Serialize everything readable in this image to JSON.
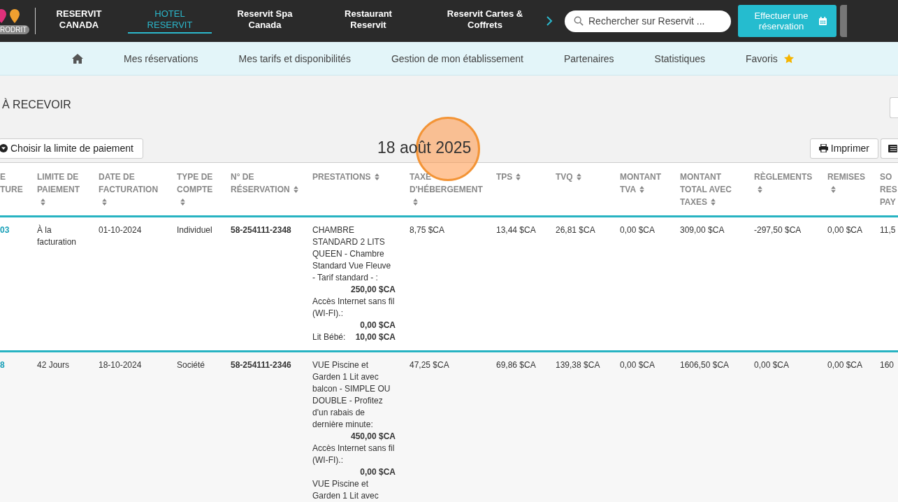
{
  "header": {
    "logo_badge": "RODRIT",
    "nav": [
      {
        "label": "RESERVIT CANADA",
        "selected": false
      },
      {
        "label": "HOTEL RESERVIT",
        "selected": true
      },
      {
        "label": "Reservit Spa Canada",
        "selected": false
      },
      {
        "label": "Restaurant Reservit",
        "selected": false
      },
      {
        "label": "Reservit Cartes & Coffrets",
        "selected": false
      }
    ],
    "search": {
      "placeholder": "Rechercher sur Reservit ..."
    },
    "booking_button": "Effectuer une réservation"
  },
  "subnav": [
    {
      "kind": "home"
    },
    {
      "kind": "text",
      "label": "Mes réservations"
    },
    {
      "kind": "text",
      "label": "Mes tarifs et disponibilités"
    },
    {
      "kind": "text",
      "label": "Gestion de mon établissement"
    },
    {
      "kind": "text",
      "label": "Partenaires"
    },
    {
      "kind": "text",
      "label": "Statistiques"
    },
    {
      "kind": "favorite",
      "label": "Favoris"
    }
  ],
  "page_title": "À RECEVOIR",
  "toolbar": {
    "filter_button": "Choisir la limite de paiement",
    "date": "18 août 2025",
    "print_button": "Imprimer"
  },
  "table": {
    "columns": [
      {
        "label": "E\nTURE",
        "kind": "link",
        "sortable": false
      },
      {
        "label": "LIMITE DE PAIEMENT",
        "kind": "text",
        "sortable": true
      },
      {
        "label": "DATE DE FACTURATION",
        "kind": "text",
        "sortable": true
      },
      {
        "label": "TYPE DE COMPTE",
        "kind": "text",
        "sortable": true
      },
      {
        "label": "N° DE RÉSERVATION",
        "kind": "bold",
        "sortable": true
      },
      {
        "label": "PRESTATIONS",
        "kind": "prestations",
        "sortable": true
      },
      {
        "label": "TAXE D'HÉBERGEMENT",
        "kind": "text",
        "sortable": true
      },
      {
        "label": "TPS",
        "kind": "text",
        "sortable": true
      },
      {
        "label": "TVQ",
        "kind": "text",
        "sortable": true
      },
      {
        "label": "MONTANT TVA",
        "kind": "text",
        "sortable": true
      },
      {
        "label": "MONTANT TOTAL AVEC TAXES",
        "kind": "text",
        "sortable": true
      },
      {
        "label": "RÈGLEMENTS",
        "kind": "text",
        "sortable": true
      },
      {
        "label": "REMISES",
        "kind": "text",
        "sortable": true
      },
      {
        "label": "SO\nRES\nPAY",
        "kind": "text",
        "sortable": false
      }
    ],
    "rows": [
      {
        "cells": [
          "03",
          "À la facturation",
          "01-10-2024",
          "Individuel",
          "58-254111-2348",
          [
            {
              "label": "CHAMBRE STANDARD 2 LITS QUEEN - Chambre Standard Vue Fleuve - Tarif standard - :",
              "amount": "250,00 $CA"
            },
            {
              "label": "Accès Internet sans fil (WI-FI).:",
              "amount": "0,00 $CA"
            },
            {
              "label": "Lit Bébé:",
              "amount": "10,00 $CA"
            }
          ],
          "8,75 $CA",
          "13,44 $CA",
          "26,81 $CA",
          "0,00 $CA",
          "309,00 $CA",
          "-297,50 $CA",
          "0,00 $CA",
          "11,5"
        ]
      },
      {
        "cells": [
          "8",
          "42 Jours",
          "18-10-2024",
          "Société",
          "58-254111-2346",
          [
            {
              "label": "VUE Piscine et Garden 1 Lit avec balcon - SIMPLE OU DOUBLE - Profitez d'un rabais de dernière minute:",
              "amount": "450,00 $CA"
            },
            {
              "label": "Accès Internet sans fil (WI-FI).:",
              "amount": "0,00 $CA"
            },
            {
              "label": "VUE Piscine et Garden 1 Lit avec"
            }
          ],
          "47,25 $CA",
          "69,86 $CA",
          "139,38 $CA",
          "0,00 $CA",
          "1606,50 $CA",
          "0,00 $CA",
          "0,00 $CA",
          "160"
        ]
      }
    ]
  }
}
